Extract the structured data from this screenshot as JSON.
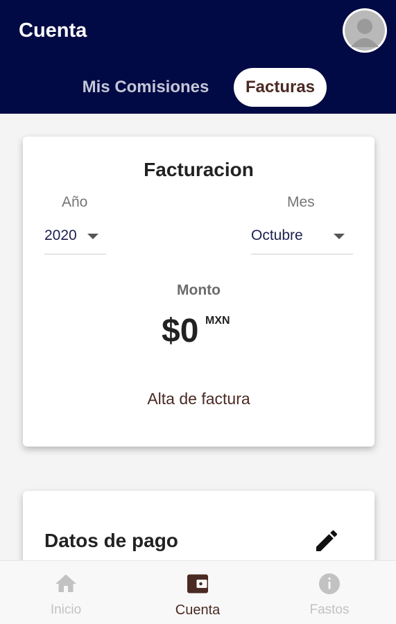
{
  "header": {
    "title": "Cuenta",
    "avatar_icon": "user-avatar-icon",
    "tabs": [
      {
        "label": "Mis Comisiones",
        "active": false
      },
      {
        "label": "Facturas",
        "active": true
      }
    ]
  },
  "billing_card": {
    "title": "Facturacion",
    "year_label": "Año",
    "year_value": "2020",
    "month_label": "Mes",
    "month_value": "Octubre",
    "amount_label": "Monto",
    "amount_value": "$0",
    "amount_currency": "MXN",
    "action_label": "Alta de factura"
  },
  "payment_card": {
    "title": "Datos de pago",
    "edit_icon": "pencil-icon"
  },
  "bottom_nav": {
    "items": [
      {
        "label": "Inicio",
        "icon": "home-icon",
        "active": false
      },
      {
        "label": "Cuenta",
        "icon": "wallet-icon",
        "active": true
      },
      {
        "label": "Fastos",
        "icon": "info-icon",
        "active": false
      }
    ]
  },
  "colors": {
    "header_bg": "#020a45",
    "accent_brown": "#4a2a22",
    "inactive_gray": "#c2c2c2"
  }
}
